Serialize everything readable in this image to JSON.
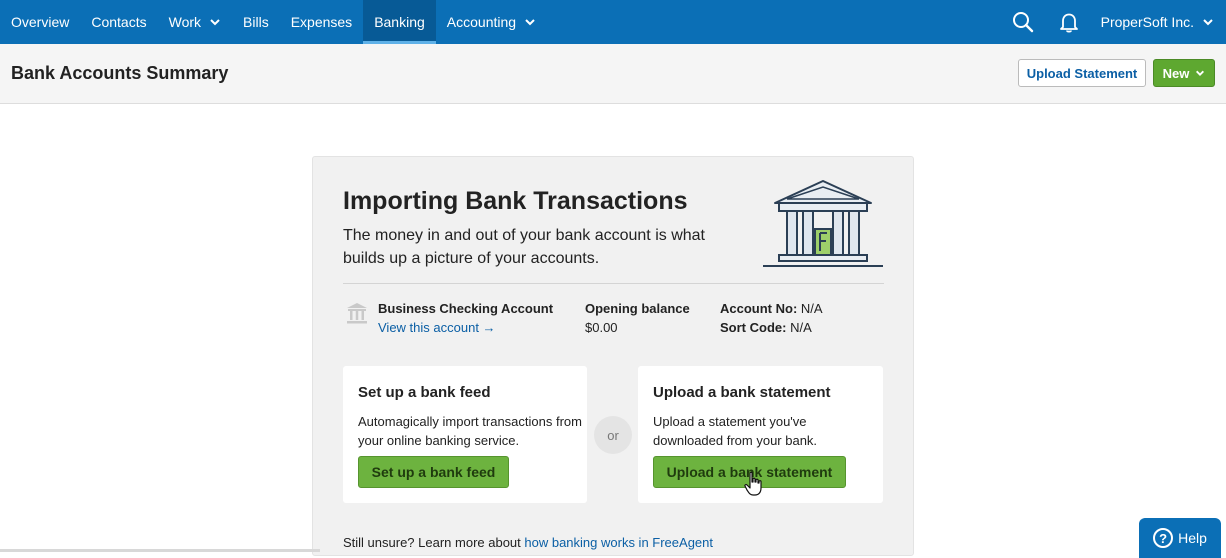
{
  "nav": {
    "items": [
      {
        "label": "Overview",
        "dropdown": false,
        "active": false
      },
      {
        "label": "Contacts",
        "dropdown": false,
        "active": false
      },
      {
        "label": "Work",
        "dropdown": true,
        "active": false
      },
      {
        "label": "Bills",
        "dropdown": false,
        "active": false
      },
      {
        "label": "Expenses",
        "dropdown": false,
        "active": false
      },
      {
        "label": "Banking",
        "dropdown": false,
        "active": true
      },
      {
        "label": "Accounting",
        "dropdown": true,
        "active": false
      }
    ],
    "company": "ProperSoft Inc.",
    "search_icon": "search-icon",
    "bell_icon": "bell-icon"
  },
  "header": {
    "title": "Bank Accounts Summary",
    "upload_label": "Upload Statement",
    "new_label": "New"
  },
  "card": {
    "title": "Importing Bank Transactions",
    "description": "The money in and out of your bank account is what builds up a picture of your accounts.",
    "account": {
      "name": "Business Checking Account",
      "view_link": "View this account →",
      "opening_balance_label": "Opening balance",
      "opening_balance_value": "$0.00",
      "account_no_label": "Account No:",
      "account_no_value": "N/A",
      "sort_code_label": "Sort Code:",
      "sort_code_value": "N/A"
    },
    "feed": {
      "title": "Set up a bank feed",
      "description": "Automagically import transactions from your online banking service.",
      "button": "Set up a bank feed"
    },
    "or_label": "or",
    "statement": {
      "title": "Upload a bank statement",
      "description": "Upload a statement you've downloaded from your bank.",
      "button": "Upload a bank statement"
    },
    "unsure_text": "Still unsure? Learn more about ",
    "unsure_link": "how banking works in FreeAgent"
  },
  "help": {
    "label": "Help"
  },
  "colors": {
    "nav_bg": "#0b6fb6",
    "nav_active": "#075a96",
    "green_button": "#6db33f",
    "new_button": "#5ea830",
    "link": "#0b5fa5"
  }
}
